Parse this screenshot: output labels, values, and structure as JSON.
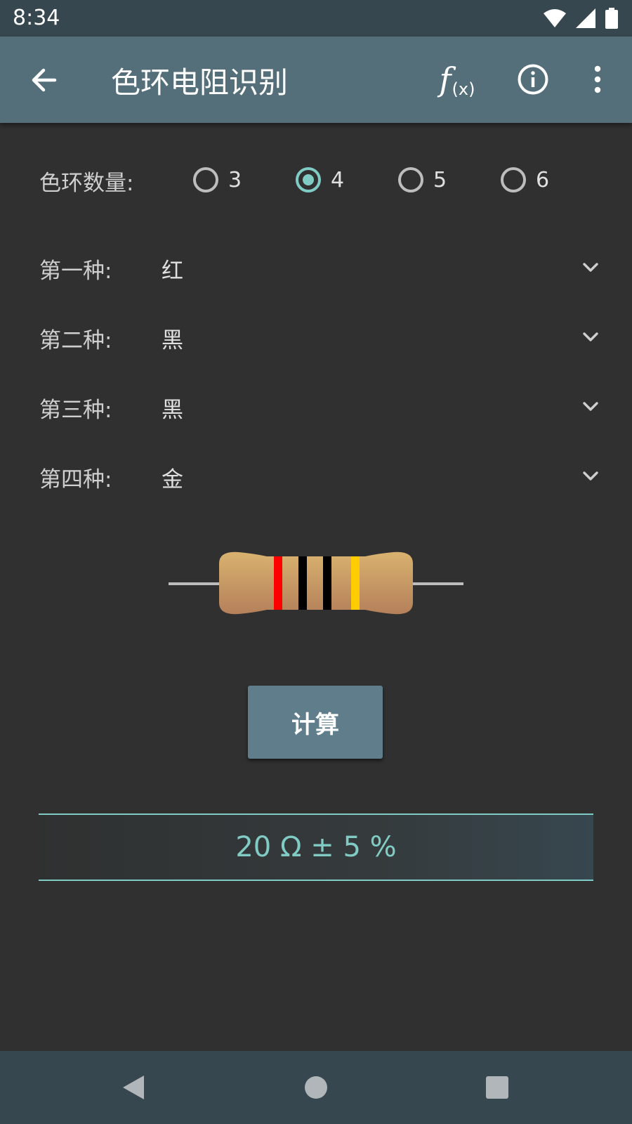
{
  "status_bar": {
    "time": "8:34"
  },
  "app_bar": {
    "title": "色环电阻识别",
    "formula_symbol": "f",
    "formula_sub": "(x)",
    "icons": [
      "back-arrow-icon",
      "formula-icon",
      "info-icon",
      "more-vert-icon"
    ]
  },
  "band_count": {
    "label": "色环数量:",
    "options": [
      "3",
      "4",
      "5",
      "6"
    ],
    "selected": "4"
  },
  "bands": [
    {
      "label": "第一种:",
      "value": "红",
      "color": "#ff0000"
    },
    {
      "label": "第二种:",
      "value": "黑",
      "color": "#000000"
    },
    {
      "label": "第三种:",
      "value": "黑",
      "color": "#000000"
    },
    {
      "label": "第四种:",
      "value": "金",
      "color": "#ffcc00"
    }
  ],
  "calculate_button": "计算",
  "result": "20 Ω ± 5 %",
  "colors": {
    "accent": "#80cbc4",
    "app_bar": "#546e7a",
    "status_bar": "#37474f",
    "background": "#303030",
    "button": "#607d8b"
  }
}
